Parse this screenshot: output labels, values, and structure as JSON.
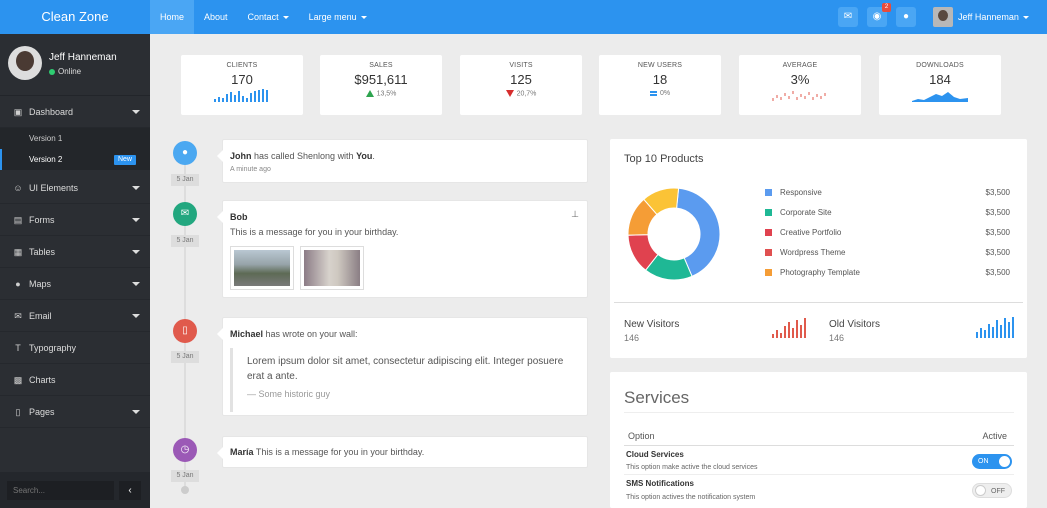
{
  "app": {
    "brand": "Clean Zone"
  },
  "topnav": {
    "home": "Home",
    "about": "About",
    "contact": "Contact",
    "large_menu": "Large menu"
  },
  "topbar": {
    "notification_count": "2",
    "user_name": "Jeff Hanneman"
  },
  "sidebar": {
    "user_name": "Jeff Hanneman",
    "status": "Online",
    "items": [
      {
        "label": "Dashboard"
      },
      {
        "label": "UI Elements"
      },
      {
        "label": "Forms"
      },
      {
        "label": "Tables"
      },
      {
        "label": "Maps"
      },
      {
        "label": "Email"
      },
      {
        "label": "Typography"
      },
      {
        "label": "Charts"
      },
      {
        "label": "Pages"
      }
    ],
    "dashboard_sub": [
      {
        "label": "Version 1"
      },
      {
        "label": "Version 2",
        "badge": "New"
      }
    ],
    "search_placeholder": "Search..."
  },
  "stats": [
    {
      "label": "CLIENTS",
      "value": "170",
      "sub": ""
    },
    {
      "label": "SALES",
      "value": "$951,611",
      "sub": "13,5%",
      "trend": "up"
    },
    {
      "label": "VISITS",
      "value": "125",
      "sub": "20,7%",
      "trend": "down"
    },
    {
      "label": "NEW USERS",
      "value": "18",
      "sub": "0%",
      "trend": "equal"
    },
    {
      "label": "AVERAGE",
      "value": "3%",
      "sub": ""
    },
    {
      "label": "DOWNLOADS",
      "value": "184",
      "sub": ""
    }
  ],
  "timeline": [
    {
      "date": "5 Jan",
      "name": "John",
      "text1": " has called Shenlong with ",
      "text2": "You",
      "text3": ".",
      "time": "A minute ago",
      "color": "#4ba8f1"
    },
    {
      "date": "5 Jan",
      "name": "Bob",
      "message": "This is a message for you in your birthday.",
      "color": "#22a77f"
    },
    {
      "date": "5 Jan",
      "name": "Michael",
      "text": " has wrote on your wall:",
      "quote": "Lorem ipsum dolor sit amet, consectetur adipiscing elit. Integer posuere erat a ante.",
      "quote_source": "— Some historic guy",
      "color": "#e05a4c"
    },
    {
      "date": "5 Jan",
      "name": "María",
      "text": " This is a message for you in your birthday.",
      "color": "#9b59b6"
    }
  ],
  "products": {
    "title": "Top 10 Products",
    "items": [
      {
        "name": "Responsive",
        "value": "$3,500",
        "color": "#5b9bef"
      },
      {
        "name": "Corporate Site",
        "value": "$3,500",
        "color": "#1fb895"
      },
      {
        "name": "Creative Portfolio",
        "value": "$3,500",
        "color": "#e0424f"
      },
      {
        "name": "Wordpress Theme",
        "value": "$3,500",
        "color": "#e05050"
      },
      {
        "name": "Photography Template",
        "value": "$3,500",
        "color": "#f59d36"
      }
    ],
    "donut": [
      {
        "share": 0.42,
        "color": "#5b9bef"
      },
      {
        "share": 0.17,
        "color": "#1fb895"
      },
      {
        "share": 0.14,
        "color": "#e0424f"
      },
      {
        "share": 0.14,
        "color": "#f59d36"
      },
      {
        "share": 0.13,
        "color": "#fbc336"
      }
    ],
    "new_visitors_label": "New Visitors",
    "new_visitors_value": "146",
    "old_visitors_label": "Old Visitors",
    "old_visitors_value": "146"
  },
  "services": {
    "title": "Services",
    "col_option": "Option",
    "col_active": "Active",
    "rows": [
      {
        "name": "Cloud Services",
        "desc": "This option make active the cloud services",
        "state": "ON"
      },
      {
        "name": "SMS Notifications",
        "desc": "This option actives the notification system",
        "state": "OFF"
      }
    ]
  }
}
